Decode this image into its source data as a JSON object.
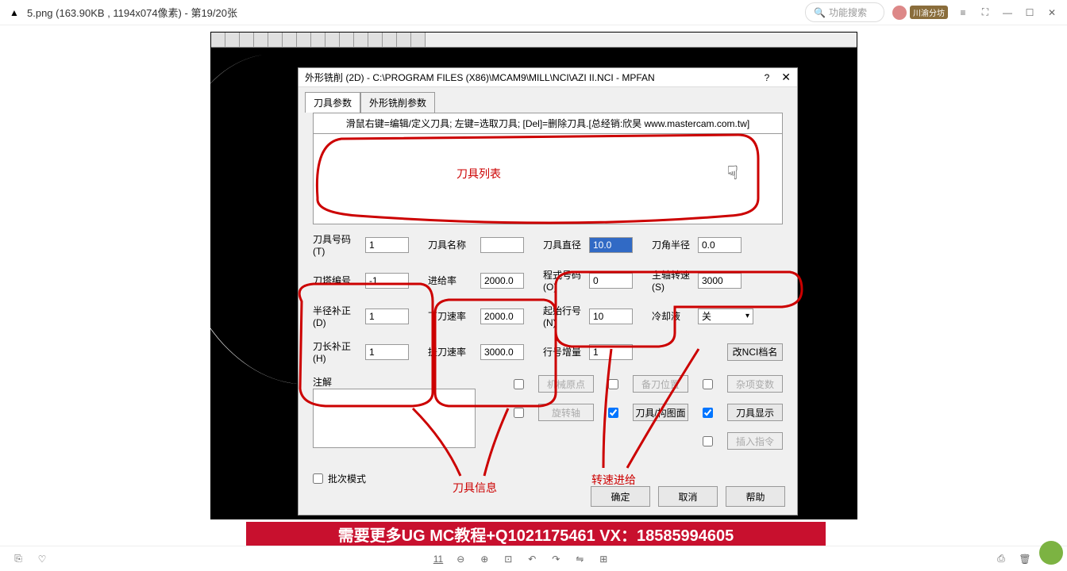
{
  "titlebar": {
    "file": "5.png (163.90KB , 1194x074像素) - 第19/20张",
    "search": "功能搜索",
    "badge": "川渝分坊"
  },
  "dialog": {
    "title": "外形铣削 (2D) - C:\\PROGRAM FILES (X86)\\MCAM9\\MILL\\NCI\\AZI II.NCI - MPFAN",
    "tabs": [
      "刀具参数",
      "外形铣削参数"
    ],
    "hint": "滑鼠右键=编辑/定义刀具; 左键=选取刀具; [Del]=删除刀具.[总经销:欣昊 www.mastercam.com.tw]",
    "annot_list": "刀具列表",
    "fields": {
      "tool_no_lbl": "刀具号码(T)",
      "tool_no": "1",
      "tool_name_lbl": "刀具名称",
      "tool_name": "",
      "tool_dia_lbl": "刀具直径",
      "tool_dia": "10.0",
      "corner_rad_lbl": "刀角半径",
      "corner_rad": "0.0",
      "turret_lbl": "刀塔编号",
      "turret": "-1",
      "feed_lbl": "进给率",
      "feed": "2000.0",
      "prog_lbl": "程式号码(O)",
      "prog": "0",
      "spindle_lbl": "主轴转速(S)",
      "spindle": "3000",
      "rad_comp_lbl": "半径补正(D)",
      "rad_comp": "1",
      "plunge_lbl": "下刀速率",
      "plunge": "2000.0",
      "start_lbl": "起始行号(N)",
      "start": "10",
      "coolant_lbl": "冷却液",
      "coolant": "关",
      "len_comp_lbl": "刀长补正(H)",
      "len_comp": "1",
      "retract_lbl": "提刀速率",
      "retract": "3000.0",
      "inc_lbl": "行号增量",
      "inc": "1",
      "comment_lbl": "注解",
      "batch_lbl": "批次模式",
      "nci_btn": "改NCI档名",
      "btn1": "机械原点",
      "btn2": "备刀位置",
      "btn3": "杂项变数",
      "btn4": "旋转轴",
      "btn5": "刀具/构图面",
      "btn6": "刀具显示",
      "btn7": "插入指令"
    },
    "annot_info": "刀具信息",
    "annot_feed": "转速进给",
    "ok": "确定",
    "cancel": "取消",
    "help": "帮助"
  },
  "banner": "需要更多UG MC教程+Q1021175461  VX：18585994605",
  "footer": {
    "page": "11"
  }
}
